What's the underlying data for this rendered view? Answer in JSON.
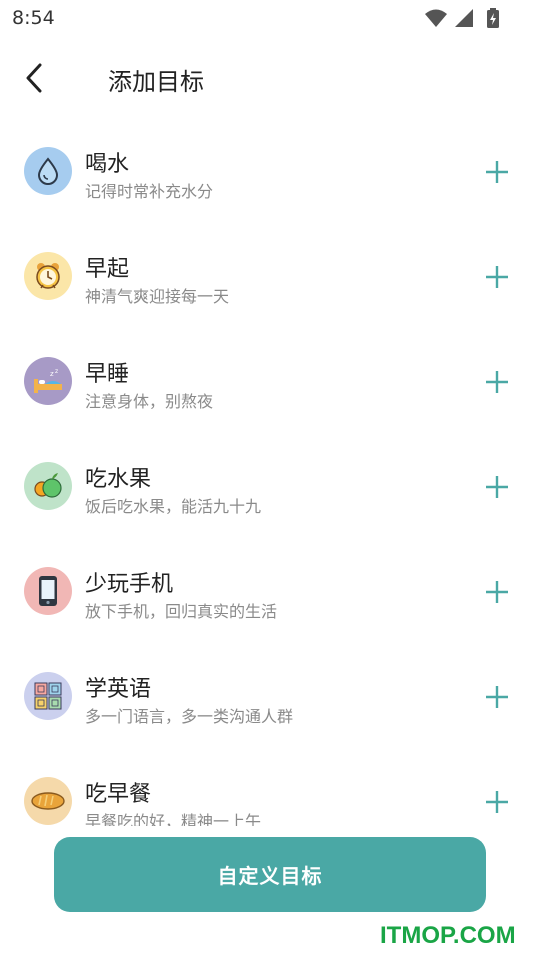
{
  "status_bar": {
    "time": "8:54"
  },
  "header": {
    "title": "添加目标",
    "back_icon": "chevron-left-icon"
  },
  "goals": [
    {
      "name": "喝水",
      "desc": "记得时常补充水分",
      "icon": "water-drop-icon",
      "color": "#a6ccef"
    },
    {
      "name": "早起",
      "desc": "神清气爽迎接每一天",
      "icon": "alarm-clock-icon",
      "color": "#fbe6a8"
    },
    {
      "name": "早睡",
      "desc": "注意身体，别熬夜",
      "icon": "sleep-bed-icon",
      "color": "#a79ac6"
    },
    {
      "name": "吃水果",
      "desc": "饭后吃水果，能活九十九",
      "icon": "fruit-icon",
      "color": "#bfe3c9"
    },
    {
      "name": "少玩手机",
      "desc": "放下手机，回归真实的生活",
      "icon": "phone-icon",
      "color": "#f1b7b5"
    },
    {
      "name": "学英语",
      "desc": "多一门语言，多一类沟通人群",
      "icon": "abc-blocks-icon",
      "color": "#cbd0ee"
    },
    {
      "name": "吃早餐",
      "desc": "早餐吃的好，精神一上午",
      "icon": "bread-icon",
      "color": "#f5d9aa"
    }
  ],
  "add_icon": "plus-icon",
  "accent_color": "#4aa8a5",
  "custom_button": {
    "label": "自定义目标"
  },
  "watermark": {
    "text": "ITMOP.COM"
  }
}
